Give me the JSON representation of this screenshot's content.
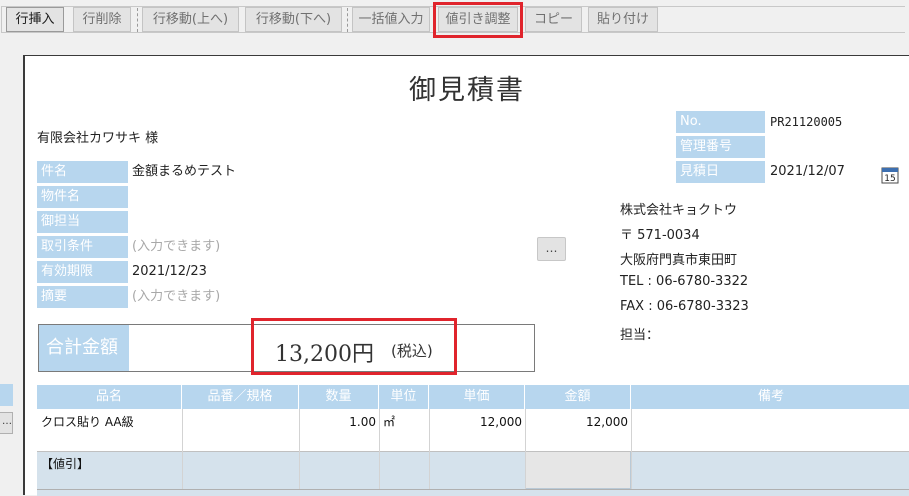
{
  "toolbar": {
    "buttons": [
      {
        "label": "行挿入"
      },
      {
        "label": "行削除"
      },
      {
        "label": "行移動(上へ)"
      },
      {
        "label": "行移動(下へ)"
      },
      {
        "label": "一括値入力"
      },
      {
        "label": "値引き調整"
      },
      {
        "label": "コピー"
      },
      {
        "label": "貼り付け"
      }
    ]
  },
  "document": {
    "title": "御見積書",
    "customer": "有限会社カワサキ 様",
    "fields": {
      "subject_label": "件名",
      "subject_value": "金額まるめテスト",
      "property_label": "物件名",
      "person_label": "御担当",
      "terms_label": "取引条件",
      "terms_placeholder": "(入力できます)",
      "expiry_label": "有効期限",
      "expiry_value": "2021/12/23",
      "summary_label": "摘要",
      "summary_placeholder": "(入力できます)"
    },
    "meta": {
      "no_label": "No.",
      "no_value": "PR21120005",
      "mgmt_label": "管理番号",
      "date_label": "見積日",
      "date_value": "2021/12/07",
      "calendar_day": "15"
    },
    "more_button": "…",
    "company": {
      "name": "株式会社キョクトウ",
      "postal": "〒 571-0034",
      "address": "大阪府門真市東田町",
      "tel": "TEL : 06-6780-3322",
      "fax": "FAX : 06-6780-3323",
      "staff": "担当："
    },
    "total": {
      "label": "合計金額",
      "amount": "13,200円",
      "tax_note": "(税込)"
    }
  },
  "table": {
    "headers": [
      "品名",
      "品番／規格",
      "数量",
      "単位",
      "単価",
      "金額",
      "備考"
    ],
    "rows": [
      {
        "name": "クロス貼り AA級",
        "code": "",
        "qty": "1.00",
        "unit": "㎡",
        "price": "12,000",
        "amount": "12,000",
        "note": ""
      },
      {
        "name": "【値引】",
        "code": "",
        "qty": "",
        "unit": "",
        "price": "",
        "amount": "",
        "note": ""
      }
    ]
  },
  "colors": {
    "label_blue": "#b7d6ee",
    "highlight_red": "#e0242c"
  }
}
